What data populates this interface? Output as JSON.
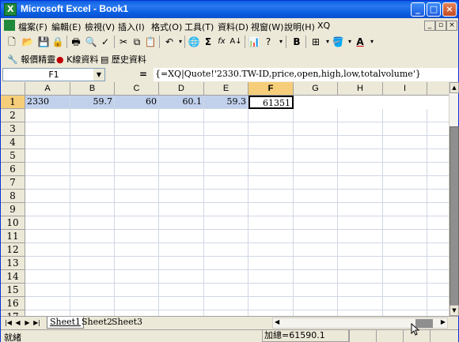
{
  "window": {
    "title": "Microsoft Excel - Book1",
    "buttons": {
      "minimize": "_",
      "maximize": "□",
      "close": "×"
    }
  },
  "menubar": {
    "items": [
      "檔案(F)",
      "編輯(E)",
      "檢視(V)",
      "插入(I)",
      "格式(O)",
      "工具(T)",
      "資料(D)",
      "視窗(W)",
      "說明(H)",
      "XQ"
    ],
    "mdi_buttons": {
      "minimize": "_",
      "restore": "▫",
      "close": "×"
    }
  },
  "toolbar2": {
    "items": [
      "報價精靈",
      "K線資料",
      "歷史資料"
    ]
  },
  "formula_bar": {
    "name_box": "F1",
    "equals": "=",
    "formula": "{=XQ|Quote!'2330.TW-ID,price,open,high,low,totalvolume'}"
  },
  "grid": {
    "columns": [
      "A",
      "B",
      "C",
      "D",
      "E",
      "F",
      "G",
      "H",
      "I"
    ],
    "rows": [
      "1",
      "2",
      "3",
      "4",
      "5",
      "6",
      "7",
      "8",
      "9",
      "10",
      "11",
      "12",
      "13",
      "14",
      "15",
      "16",
      "17"
    ],
    "row1": [
      "2330",
      "59.7",
      "60",
      "60.1",
      "59.3",
      "61351"
    ]
  },
  "sheets": {
    "tabs": [
      "Sheet1",
      "Sheet2",
      "Sheet3"
    ],
    "active": "Sheet1"
  },
  "status": {
    "ready": "就緒",
    "sum": "加總=61590.1"
  },
  "colors": {
    "titlebar": "#0a5ee0",
    "selection": "#c1d1ec",
    "header_selected": "#f6ce7a"
  }
}
